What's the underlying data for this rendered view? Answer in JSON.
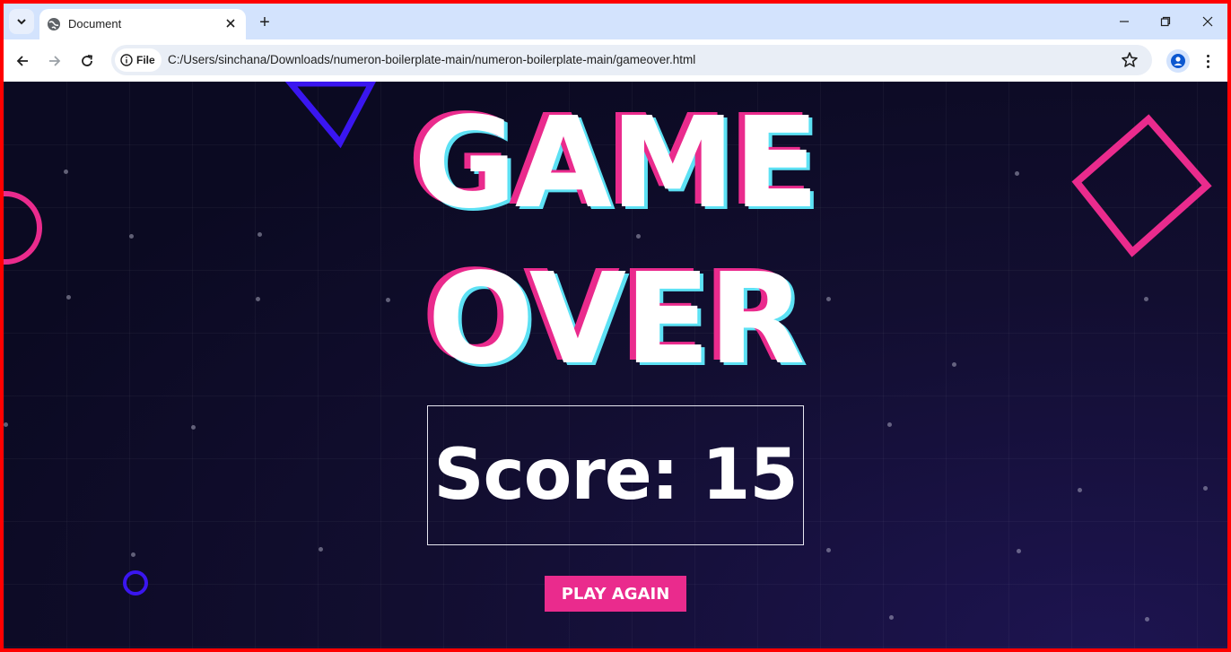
{
  "browser": {
    "tab": {
      "title": "Document",
      "favicon": "globe-icon"
    },
    "new_tab_label": "+",
    "site_chip_label": "File",
    "url": "C:/Users/sinchana/Downloads/numeron-boilerplate-main/numeron-boilerplate-main/gameover.html",
    "window_controls": [
      "minimize-icon",
      "restore-icon",
      "close-icon"
    ]
  },
  "page": {
    "title_line_1": "GAME",
    "title_line_2": "OVER",
    "score_text": "Score: 15",
    "play_again_label": "PLAY AGAIN"
  },
  "colors": {
    "accent_pink": "#ea2b8d",
    "accent_cyan": "#5de1f4",
    "accent_blue": "#3a16f0",
    "background": "#0b0a22",
    "frame": "#ff0000"
  }
}
